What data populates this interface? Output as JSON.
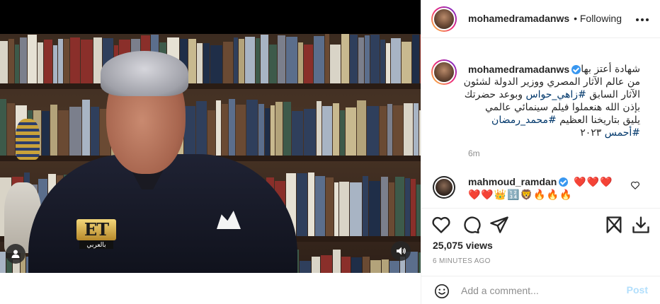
{
  "header": {
    "username": "mohamedramadanws",
    "separator": "•",
    "follow_status": "Following"
  },
  "video": {
    "channel_logo": "ET",
    "channel_logo_sub": "بالعربي",
    "mute_icon": "volume-icon",
    "avatar_icon": "user-tag-icon"
  },
  "caption": {
    "username": "mohamedramadanws",
    "line1": "شهادة أعتز بها",
    "line2": "من عالم الآثار المصري ووزير الدولة لشئون",
    "line3_pre": "الآثار السابق ",
    "line3_tag": "#زاهي_حواس",
    "line3_post": " وبوعد حضرتك",
    "line4": "بإذن الله هنعملوا فيلم سينمائي عالمي",
    "line5_pre": "يليق بتاريخنا العظيم ",
    "line5_tag": "#محمد_رمضان",
    "line6_pre": "#أحمس",
    "line6_post": " ٢٠٢٣",
    "time": "6m"
  },
  "comment": {
    "username": "mahmoud_ramdan",
    "line1": "❤️❤️❤️",
    "line2": "❤️❤️👑🔢🦁🔥🔥🔥"
  },
  "stats": {
    "views": "25,075 views",
    "posted_ago": "6 MINUTES AGO"
  },
  "comment_bar": {
    "placeholder": "Add a comment...",
    "post_label": "Post"
  },
  "colors": {
    "accent_link": "#00376b",
    "verified": "#3897f0",
    "post_disabled": "#b2dffc",
    "muted_text": "#8e8e8e"
  }
}
